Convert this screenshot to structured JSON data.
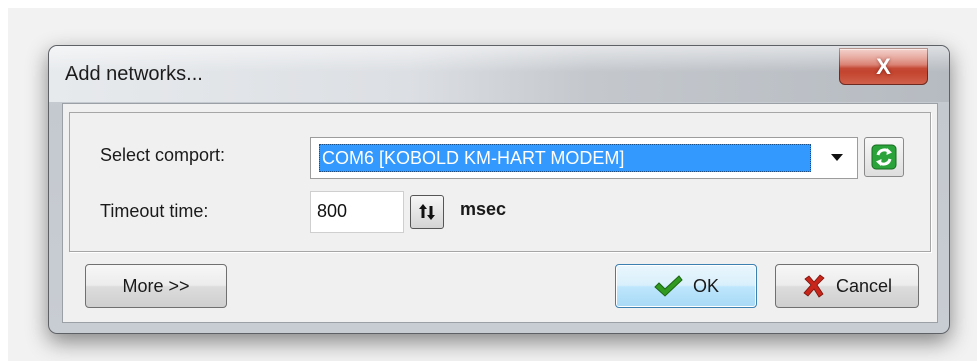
{
  "window": {
    "title": "Add networks...",
    "close_label": "X"
  },
  "form": {
    "comport_label": "Select comport:",
    "comport_value": "COM6 [KOBOLD KM-HART MODEM]",
    "timeout_label": "Timeout time:",
    "timeout_value": "800",
    "timeout_unit": "msec"
  },
  "buttons": {
    "more": "More >>",
    "ok": "OK",
    "cancel": "Cancel"
  },
  "icons": {
    "refresh": "refresh-icon",
    "spin": "spin-arrows-icon",
    "ok": "checkmark-icon",
    "cancel": "x-icon",
    "dropdown": "chevron-down-icon"
  },
  "colors": {
    "selection": "#3399ff",
    "ok_check": "#2f9a1f",
    "cancel_x": "#c8261b",
    "refresh": "#2aa43a"
  }
}
